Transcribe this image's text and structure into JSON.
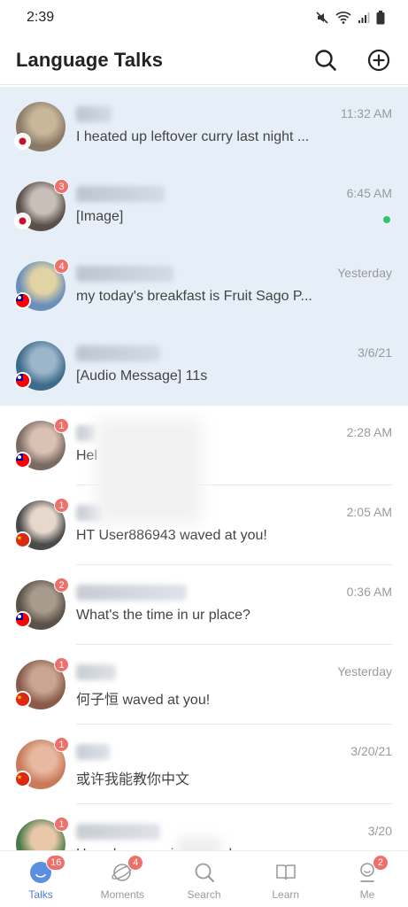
{
  "status_bar": {
    "time": "2:39",
    "icons": [
      "mute-icon",
      "wifi-icon",
      "signal-icon",
      "battery-icon"
    ]
  },
  "header": {
    "title": "Language Talks",
    "search_icon": "search-icon",
    "add_icon": "add-circle-icon"
  },
  "colors": {
    "pinned_bg": "#e6eef8",
    "badge": "#ef6f6a",
    "accent": "#4a7fd4",
    "online": "#36c26c"
  },
  "chats": [
    {
      "time": "11:32 AM",
      "preview": "I heated up leftover curry last night ...",
      "badge": "",
      "flag": "japan",
      "pinned": true,
      "online": false
    },
    {
      "time": "6:45 AM",
      "preview": "[Image]",
      "badge": "3",
      "flag": "japan",
      "pinned": true,
      "online": true
    },
    {
      "time": "Yesterday",
      "preview": "my today's breakfast is Fruit Sago P...",
      "badge": "4",
      "flag": "taiwan",
      "pinned": true,
      "online": false
    },
    {
      "time": "3/6/21",
      "preview": "[Audio Message] 11s",
      "badge": "",
      "flag": "taiwan",
      "pinned": true,
      "online": false
    },
    {
      "time": "2:28 AM",
      "preview": "Hel",
      "badge": "1",
      "flag": "taiwan",
      "pinned": false,
      "online": false
    },
    {
      "time": "2:05 AM",
      "preview": "HT User886943 waved at you!",
      "badge": "1",
      "flag": "china",
      "pinned": false,
      "online": false
    },
    {
      "time": "0:36 AM",
      "preview": "What's the time in ur place?",
      "badge": "2",
      "flag": "taiwan",
      "pinned": false,
      "online": false
    },
    {
      "time": "Yesterday",
      "preview": "何子恒 waved at you!",
      "badge": "1",
      "flag": "china",
      "pinned": false,
      "online": false
    },
    {
      "time": "3/20/21",
      "preview": "或许我能教你中文",
      "badge": "1",
      "flag": "china",
      "pinned": false,
      "online": false
    },
    {
      "time": "3/20",
      "preview": "How do you enjoy ... under quar",
      "badge": "1",
      "flag": "",
      "pinned": false,
      "online": false
    }
  ],
  "nav": [
    {
      "label": "Talks",
      "icon": "talks-icon",
      "badge": "16",
      "active": true
    },
    {
      "label": "Moments",
      "icon": "moments-icon",
      "badge": "4",
      "active": false
    },
    {
      "label": "Search",
      "icon": "search-icon",
      "badge": "",
      "active": false
    },
    {
      "label": "Learn",
      "icon": "learn-book-icon",
      "badge": "",
      "active": false
    },
    {
      "label": "Me",
      "icon": "me-profile-icon",
      "badge": "2",
      "active": false
    }
  ]
}
